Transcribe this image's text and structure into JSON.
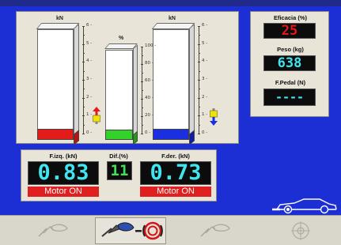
{
  "gauges": {
    "left": {
      "unit": "kN",
      "ticks": [
        "6",
        "5",
        "4",
        "3",
        "2",
        "1",
        "0"
      ],
      "max": 6,
      "level_fraction": 0.1,
      "fill_color": "#e41b1b",
      "side_color": "#b51212"
    },
    "diff": {
      "unit": "%",
      "ticks": [
        "100",
        "80",
        "60",
        "40",
        "20",
        "0"
      ],
      "max": 100,
      "level_fraction": 0.11,
      "fill_color": "#33d22b",
      "side_color": "#1f9d1a"
    },
    "right": {
      "unit": "kN",
      "ticks": [
        "6",
        "5",
        "4",
        "3",
        "2",
        "1",
        "0"
      ],
      "max": 6,
      "level_fraction": 0.1,
      "fill_color": "#1a2fe0",
      "side_color": "#0f1ea8"
    }
  },
  "readouts": {
    "efficacy_label": "Eficacia (%)",
    "efficacy_value": "25",
    "efficacy_color": "#e8161a",
    "weight_label": "Peso (kg)",
    "weight_value": "638",
    "weight_color": "#3fe6f0",
    "pedal_label": "F.Pedal (N)",
    "pedal_value": "----",
    "pedal_color": "#3fe6f0"
  },
  "forces": {
    "left_label": "F.izq. (kN)",
    "left_value": "0.83",
    "left_status": "Motor ON",
    "diff_label": "Dif.(%)",
    "diff_value": "11",
    "right_label": "F.der. (kN)",
    "right_value": "0.73",
    "right_status": "Motor ON",
    "value_color": "#3fe6f0",
    "diff_color": "#3fe25a",
    "status_color": "#e02020"
  },
  "toolbar": {
    "items": [
      "brake-pad-disabled-icon",
      "brake-disc-active-icon",
      "brake-pad-disabled-icon",
      "target-disabled-icon"
    ]
  },
  "colors": {
    "background": "#1c2fd4",
    "panel": "#e8e4d8",
    "toolbar": "#d9d6cc",
    "up_arrow": "#e41b1b",
    "down_arrow": "#1a2fe0",
    "arrow_body": "#f0e10f"
  }
}
